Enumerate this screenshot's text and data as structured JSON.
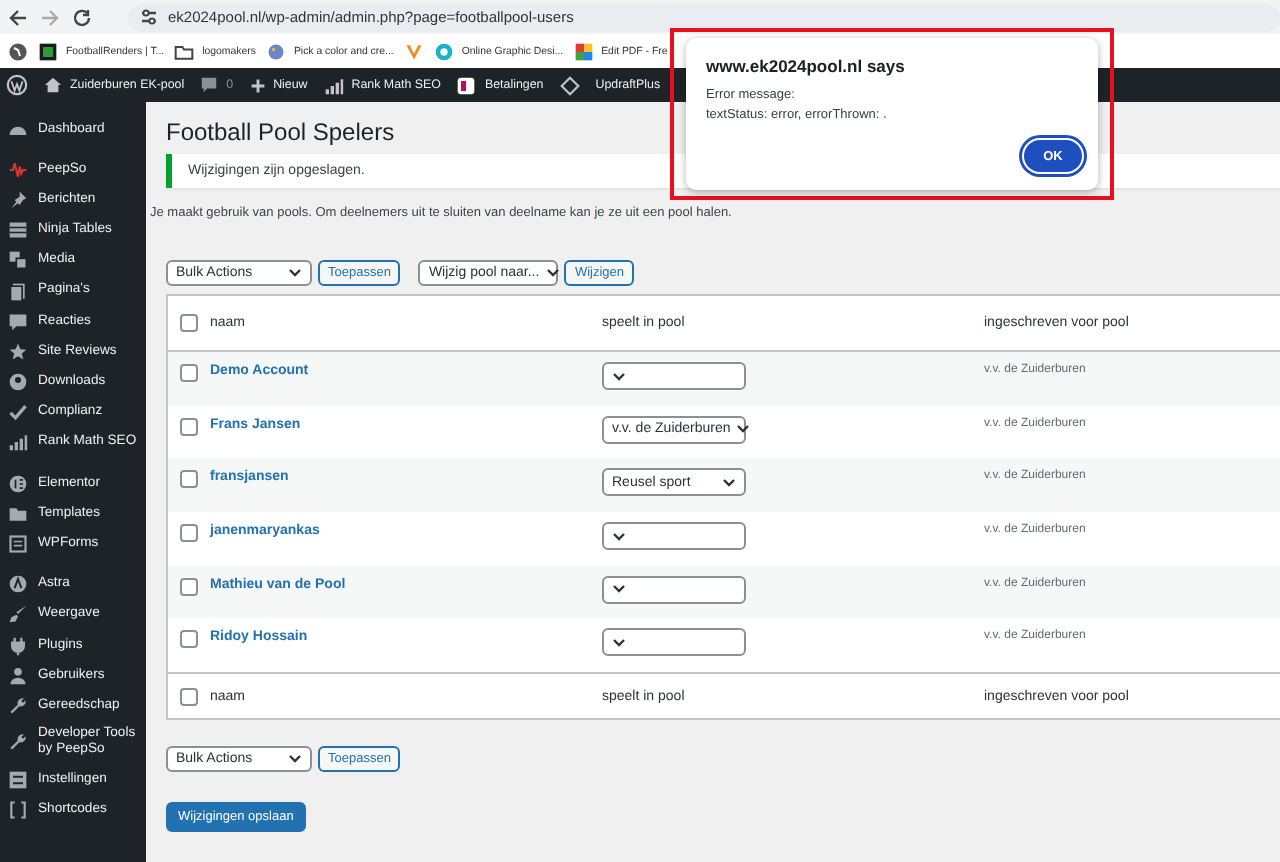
{
  "browser": {
    "url": "ek2024pool.nl/wp-admin/admin.php?page=footballpool-users",
    "bookmarks": [
      {
        "kind": "link",
        "label": "FootballRenders | T..."
      },
      {
        "kind": "link",
        "label": "logomakers"
      },
      {
        "kind": "link",
        "label": "Pick a color and cre..."
      },
      {
        "kind": "icon"
      },
      {
        "kind": "link",
        "label": "Online Graphic Desi..."
      },
      {
        "kind": "link",
        "label": "Edit PDF - Fre"
      }
    ]
  },
  "admin_bar": {
    "site": "Zuiderburen EK-pool",
    "comments": "0",
    "new": "Nieuw",
    "items": [
      {
        "kind": "link",
        "label": "Rank Math SEO"
      },
      {
        "kind": "link",
        "label": "Betalingen"
      },
      {
        "kind": "icon"
      },
      {
        "kind": "link",
        "label": "UpdraftPlus"
      }
    ]
  },
  "sidebar": {
    "groups": [
      [
        "Dashboard"
      ],
      [
        "PeepSo",
        "Berichten",
        "Ninja Tables",
        "Media",
        "Pagina's",
        "Reacties",
        "Site Reviews",
        "Downloads",
        "Complianz",
        "Rank Math SEO"
      ],
      [
        "Elementor",
        "Templates",
        "WPForms"
      ],
      [
        "Astra",
        "Weergave",
        "Plugins",
        "Gebruikers",
        "Gereedschap",
        "Developer Tools by PeepSo",
        "Instellingen",
        "Shortcodes"
      ]
    ]
  },
  "page": {
    "title": "Football Pool Spelers",
    "notice": "Wijzigingen zijn opgeslagen.",
    "intro": "Je maakt gebruik van pools. Om deelnemers uit te sluiten van deelname kan je ze uit een pool halen.",
    "bulk_actions": "Bulk Actions",
    "apply": "Toepassen",
    "change_pool": "Wijzig pool naar...",
    "change": "Wijzigen",
    "header_checked": false,
    "columns": [
      "naam",
      "speelt in pool",
      "ingeschreven voor pool"
    ],
    "rows": [
      {
        "checked": false,
        "name": "Demo Account",
        "pool": "",
        "registered": "v.v. de Zuiderburen"
      },
      {
        "checked": false,
        "name": "Frans Jansen",
        "pool": "v.v. de Zuiderburen",
        "registered": "v.v. de Zuiderburen"
      },
      {
        "checked": false,
        "name": "fransjansen",
        "pool": "Reusel sport",
        "registered": "v.v. de Zuiderburen"
      },
      {
        "checked": false,
        "name": "janenmaryankas",
        "pool": "",
        "registered": "v.v. de Zuiderburen"
      },
      {
        "checked": false,
        "name": "Mathieu van de Pool",
        "pool": "",
        "registered": "v.v. de Zuiderburen"
      },
      {
        "checked": false,
        "name": "Ridoy Hossain",
        "pool": "",
        "registered": "v.v. de Zuiderburen"
      }
    ],
    "footer_checked": false,
    "footer_columns": [
      "naam",
      "speelt in pool",
      "ingeschreven voor pool"
    ],
    "bottom_bulk_actions": "Bulk Actions",
    "bottom_apply": "Toepassen",
    "save": "Wijzigingen opslaan"
  },
  "dialog": {
    "title": "www.ek2024pool.nl says",
    "message": [
      "Error message:",
      "textStatus: error, errorThrown: ."
    ],
    "ok": "OK"
  }
}
